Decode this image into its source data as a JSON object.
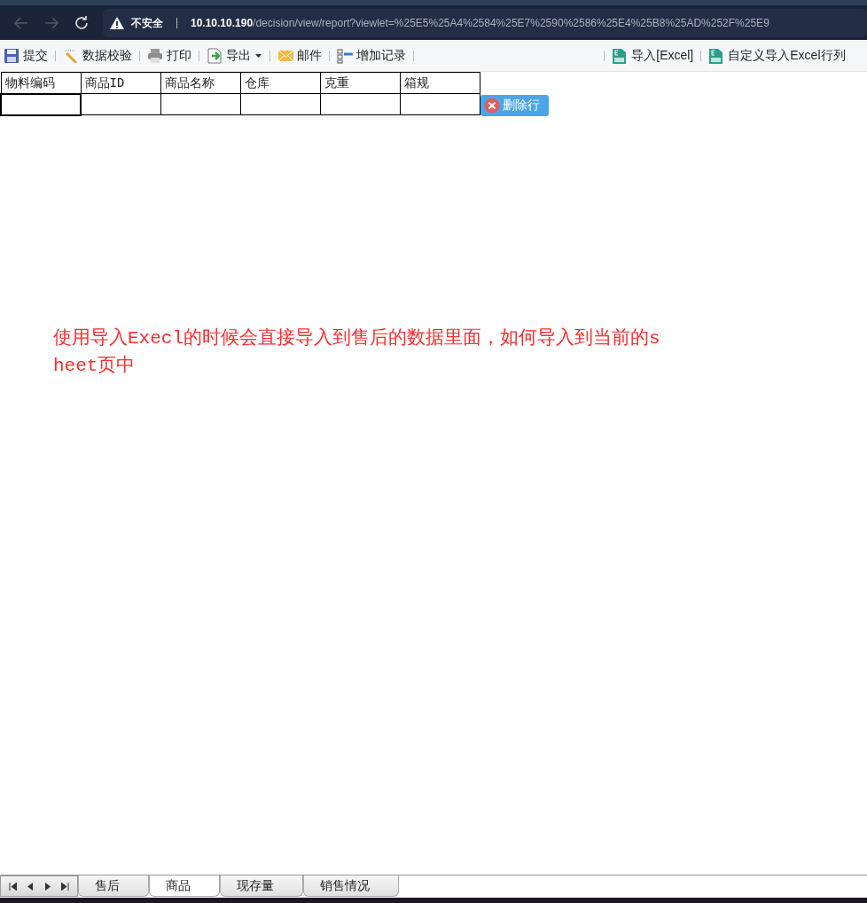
{
  "browser": {
    "security_label": "不安全",
    "url_host": "10.10.10.190",
    "url_path": "/decision/view/report?viewlet=%25E5%25A4%2584%25E7%2590%2586%25E4%25B8%25AD%252F%25E9"
  },
  "toolbar": {
    "left": [
      {
        "kind": "save",
        "label": "提交"
      },
      {
        "kind": "check",
        "label": "数据校验"
      },
      {
        "kind": "print",
        "label": "打印"
      },
      {
        "kind": "export",
        "label": "导出",
        "dropdown": true
      },
      {
        "kind": "mail",
        "label": "邮件"
      },
      {
        "kind": "addrow",
        "label": "增加记录"
      }
    ],
    "right": [
      {
        "kind": "excel",
        "label": "导入[Excel]"
      },
      {
        "kind": "excel",
        "label": "自定义导入Excel行列"
      }
    ]
  },
  "table": {
    "columns": [
      "物料编码",
      "商品ID",
      "商品名称",
      "仓库",
      "克重",
      "箱规"
    ],
    "delete_button": "删除行"
  },
  "note": "使用导入Execl的时候会直接导入到售后的数据里面，如何导入到当前的sheet页中",
  "sheet_tabs": [
    {
      "label": "售后",
      "selected": false
    },
    {
      "label": "商品",
      "selected": true
    },
    {
      "label": "现存量",
      "selected": false
    },
    {
      "label": "销售情况",
      "selected": false
    }
  ]
}
